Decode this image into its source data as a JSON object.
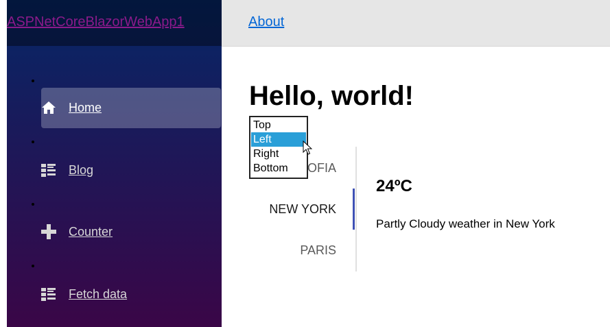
{
  "sidebar": {
    "brand": "ASPNetCoreBlazorWebApp1",
    "items": [
      {
        "label": "Home",
        "icon": "home-icon",
        "active": true
      },
      {
        "label": "Blog",
        "icon": "list-icon",
        "active": false
      },
      {
        "label": "Counter",
        "icon": "plus-icon",
        "active": false
      },
      {
        "label": "Fetch data",
        "icon": "list-icon",
        "active": false
      }
    ]
  },
  "header": {
    "about_label": "About"
  },
  "main": {
    "title": "Hello, world!",
    "tabs": [
      {
        "label": "SOFIA",
        "active": false
      },
      {
        "label": "NEW YORK",
        "active": true
      },
      {
        "label": "PARIS",
        "active": false
      }
    ],
    "panel": {
      "temperature": "24ºC",
      "description": "Partly Cloudy weather in New York"
    }
  },
  "position_dropdown": {
    "options": [
      "Top",
      "Left",
      "Right",
      "Bottom"
    ],
    "selected": "Left"
  },
  "colors": {
    "sidebar_top": "#052767",
    "sidebar_bottom": "#3a0647",
    "accent": "#3f51b5",
    "link": "#0366d6",
    "selection": "#2a9fd8"
  }
}
